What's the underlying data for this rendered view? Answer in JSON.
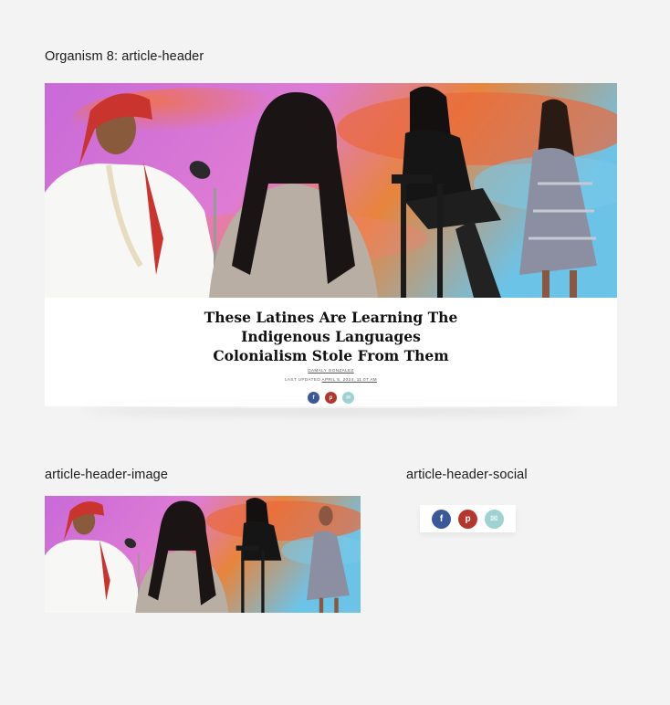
{
  "labels": {
    "main": "Organism 8: article-header",
    "image": "article-header-image",
    "social": "article-header-social"
  },
  "article": {
    "title_lines": [
      "These Latines Are Learning The",
      "Indigenous Languages",
      "Colonialism Stole From Them"
    ],
    "author": "DAMALY GONZALEZ",
    "updated_prefix": "LAST UPDATED",
    "updated_date": "APRIL 5, 2024, 11:07 AM"
  },
  "social": {
    "facebook_glyph": "f",
    "pinterest_glyph": "p",
    "email_glyph": "✉",
    "icons": [
      "facebook-icon",
      "pinterest-icon",
      "email-icon"
    ]
  },
  "colors": {
    "facebook": "#3b5998",
    "pinterest": "#b5362c",
    "email": "#9fd3d3",
    "hero_pink": "#d774d6",
    "hero_orange": "#e8703a",
    "hero_blue": "#7ec7e6"
  }
}
